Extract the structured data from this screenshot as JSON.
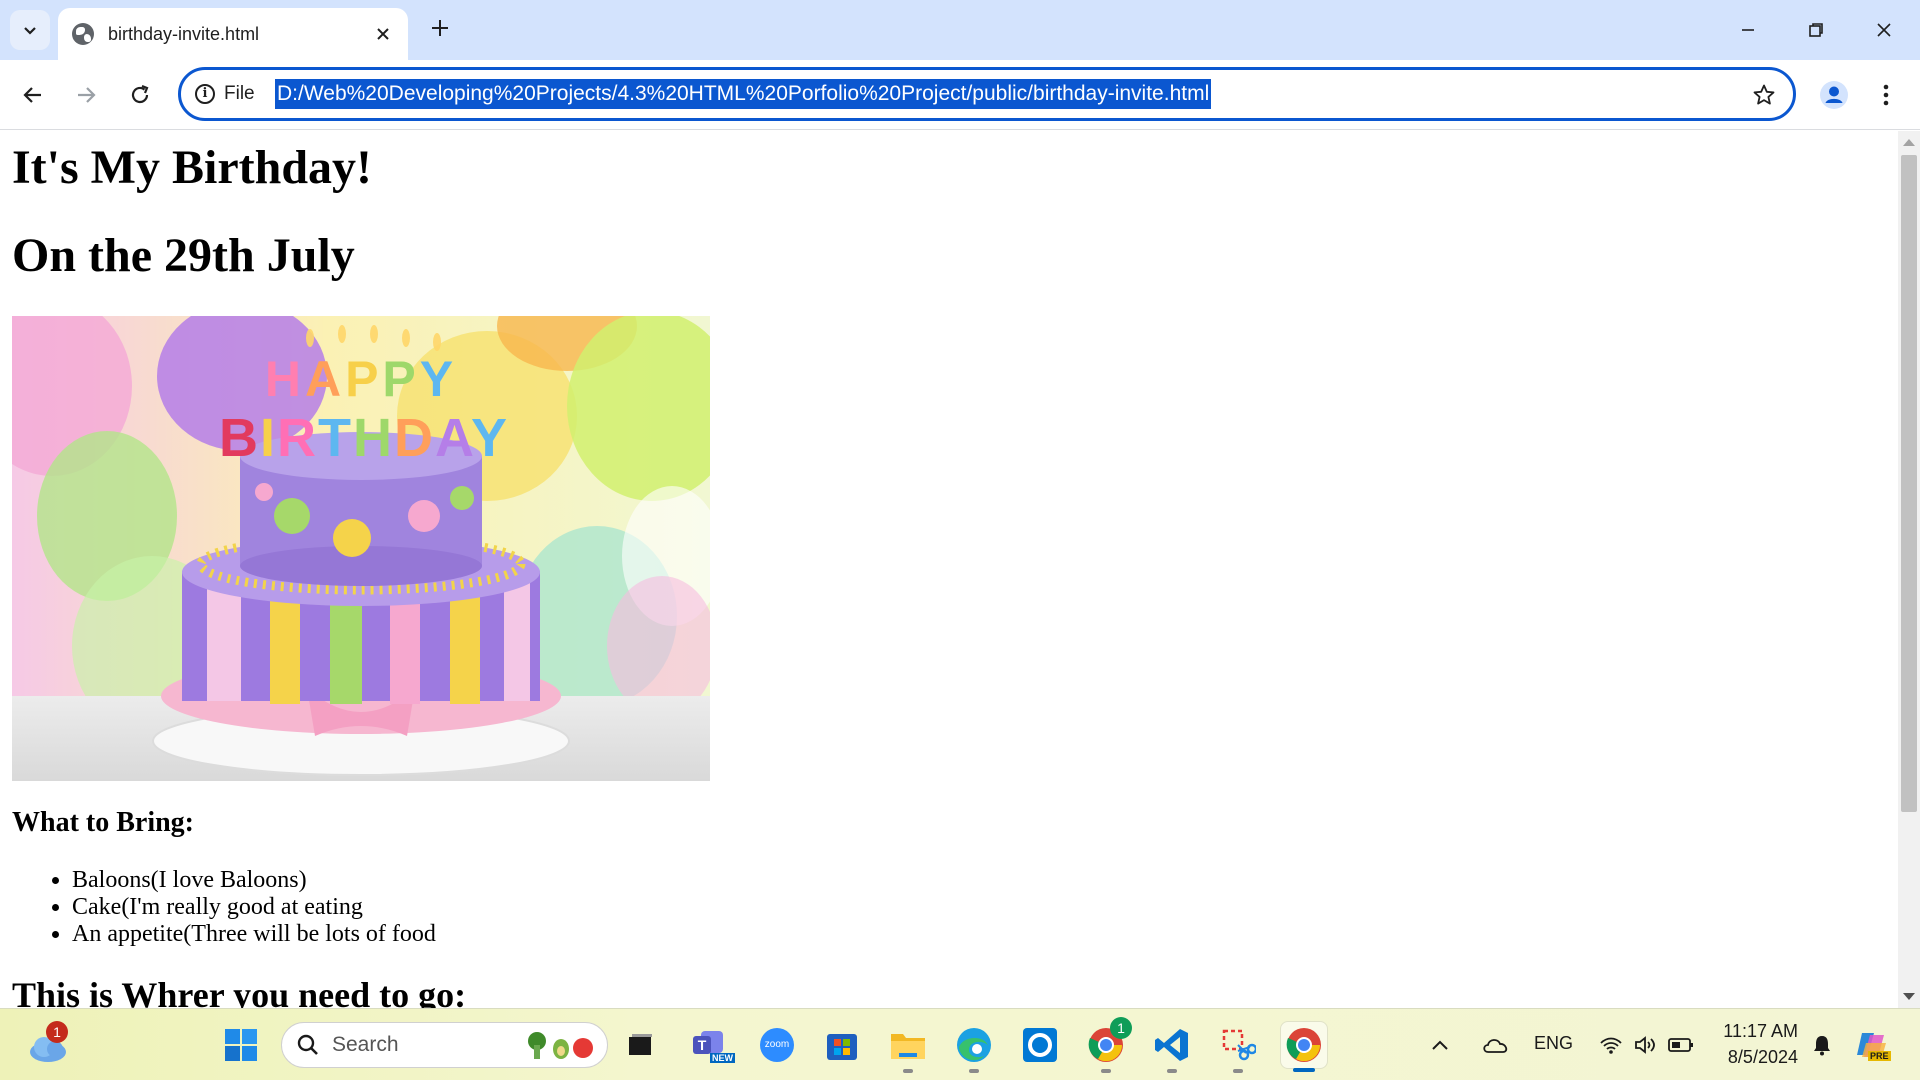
{
  "browser": {
    "tab_title": "birthday-invite.html",
    "site_info_label": "File",
    "url": "D:/Web%20Developing%20Projects/4.3%20HTML%20Porfolio%20Project/public/birthday-invite.html"
  },
  "page": {
    "heading_1": "It's My Birthday!",
    "heading_2": "On the 29th July",
    "image_text": "HAPPY BIRTHDAY",
    "bring_heading": "What to Bring:",
    "bring_items": [
      "Baloons(I love Baloons)",
      "Cake(I'm really good at eating",
      "An appetite(Three will be lots of food"
    ],
    "where_heading": "This is Whrer you need to go:"
  },
  "taskbar": {
    "weather_badge": "1",
    "search_placeholder": "Search",
    "chrome_badge": "1",
    "teams_label": "NEW",
    "zoom_label": "zoom",
    "language": "ENG",
    "time": "11:17 AM",
    "date": "8/5/2024",
    "copilot_label": "PRE"
  },
  "colors": {
    "tabbar": "#d3e3fd",
    "accent": "#0b57d0",
    "taskbar": "#f3f5d4"
  }
}
